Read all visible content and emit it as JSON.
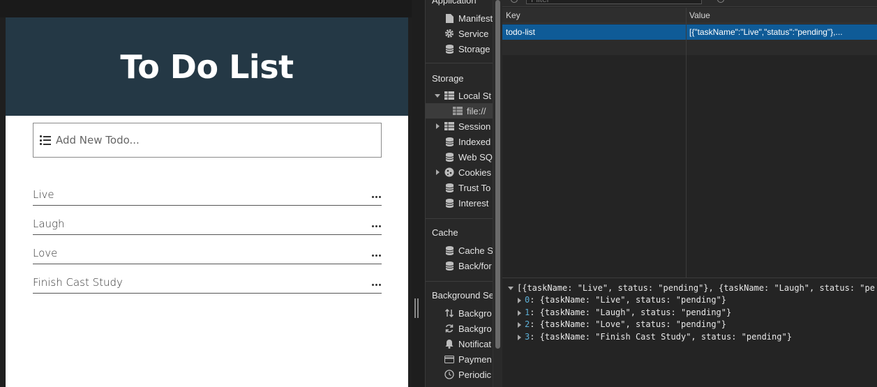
{
  "app": {
    "title": "To Do List",
    "input_placeholder": "Add New Todo...",
    "todos": [
      {
        "text": "Live"
      },
      {
        "text": "Laugh"
      },
      {
        "text": "Love"
      },
      {
        "text": "Finish Cast Study"
      }
    ]
  },
  "devtools": {
    "sidebar": {
      "application_header": "Application",
      "application_items": [
        {
          "label": "Manifest",
          "icon": "file-icon"
        },
        {
          "label": "Service",
          "icon": "gear-icon"
        },
        {
          "label": "Storage",
          "icon": "database-icon"
        }
      ],
      "storage_header": "Storage",
      "storage_items": [
        {
          "label": "Local St",
          "icon": "grid-icon"
        },
        {
          "label": "file://",
          "icon": "grid-icon"
        },
        {
          "label": "Session",
          "icon": "grid-icon"
        },
        {
          "label": "Indexed",
          "icon": "database-icon"
        },
        {
          "label": "Web SQ",
          "icon": "database-icon"
        },
        {
          "label": "Cookies",
          "icon": "cookie-icon"
        },
        {
          "label": "Trust To",
          "icon": "database-icon"
        },
        {
          "label": "Interest",
          "icon": "database-icon"
        }
      ],
      "cache_header": "Cache",
      "cache_items": [
        {
          "label": "Cache S",
          "icon": "database-icon"
        },
        {
          "label": "Back/for",
          "icon": "database-icon"
        }
      ],
      "background_header": "Background Se",
      "background_items": [
        {
          "label": "Backgro",
          "icon": "arrows-updown-icon"
        },
        {
          "label": "Backgro",
          "icon": "sync-icon"
        },
        {
          "label": "Notificat",
          "icon": "bell-icon"
        },
        {
          "label": "Paymen",
          "icon": "card-icon"
        },
        {
          "label": "Periodic",
          "icon": "clock-icon"
        }
      ]
    },
    "filter_placeholder": "Filter",
    "table": {
      "key_header": "Key",
      "value_header": "Value",
      "rows": [
        {
          "key": "todo-list",
          "value": "[{\"taskName\":\"Live\",\"status\":\"pending\"},..."
        }
      ]
    },
    "preview": {
      "summary": "[{taskName: \"Live\", status: \"pending\"}, {taskName: \"Laugh\", status: \"pe",
      "items": [
        {
          "index": "0",
          "text": ": {taskName: \"Live\", status: \"pending\"}"
        },
        {
          "index": "1",
          "text": ": {taskName: \"Laugh\", status: \"pending\"}"
        },
        {
          "index": "2",
          "text": ": {taskName: \"Love\", status: \"pending\"}"
        },
        {
          "index": "3",
          "text": ": {taskName: \"Finish Cast Study\", status: \"pending\"}"
        }
      ]
    },
    "colors": {
      "header_bg": "#243845",
      "selection": "#0f5b97"
    }
  }
}
